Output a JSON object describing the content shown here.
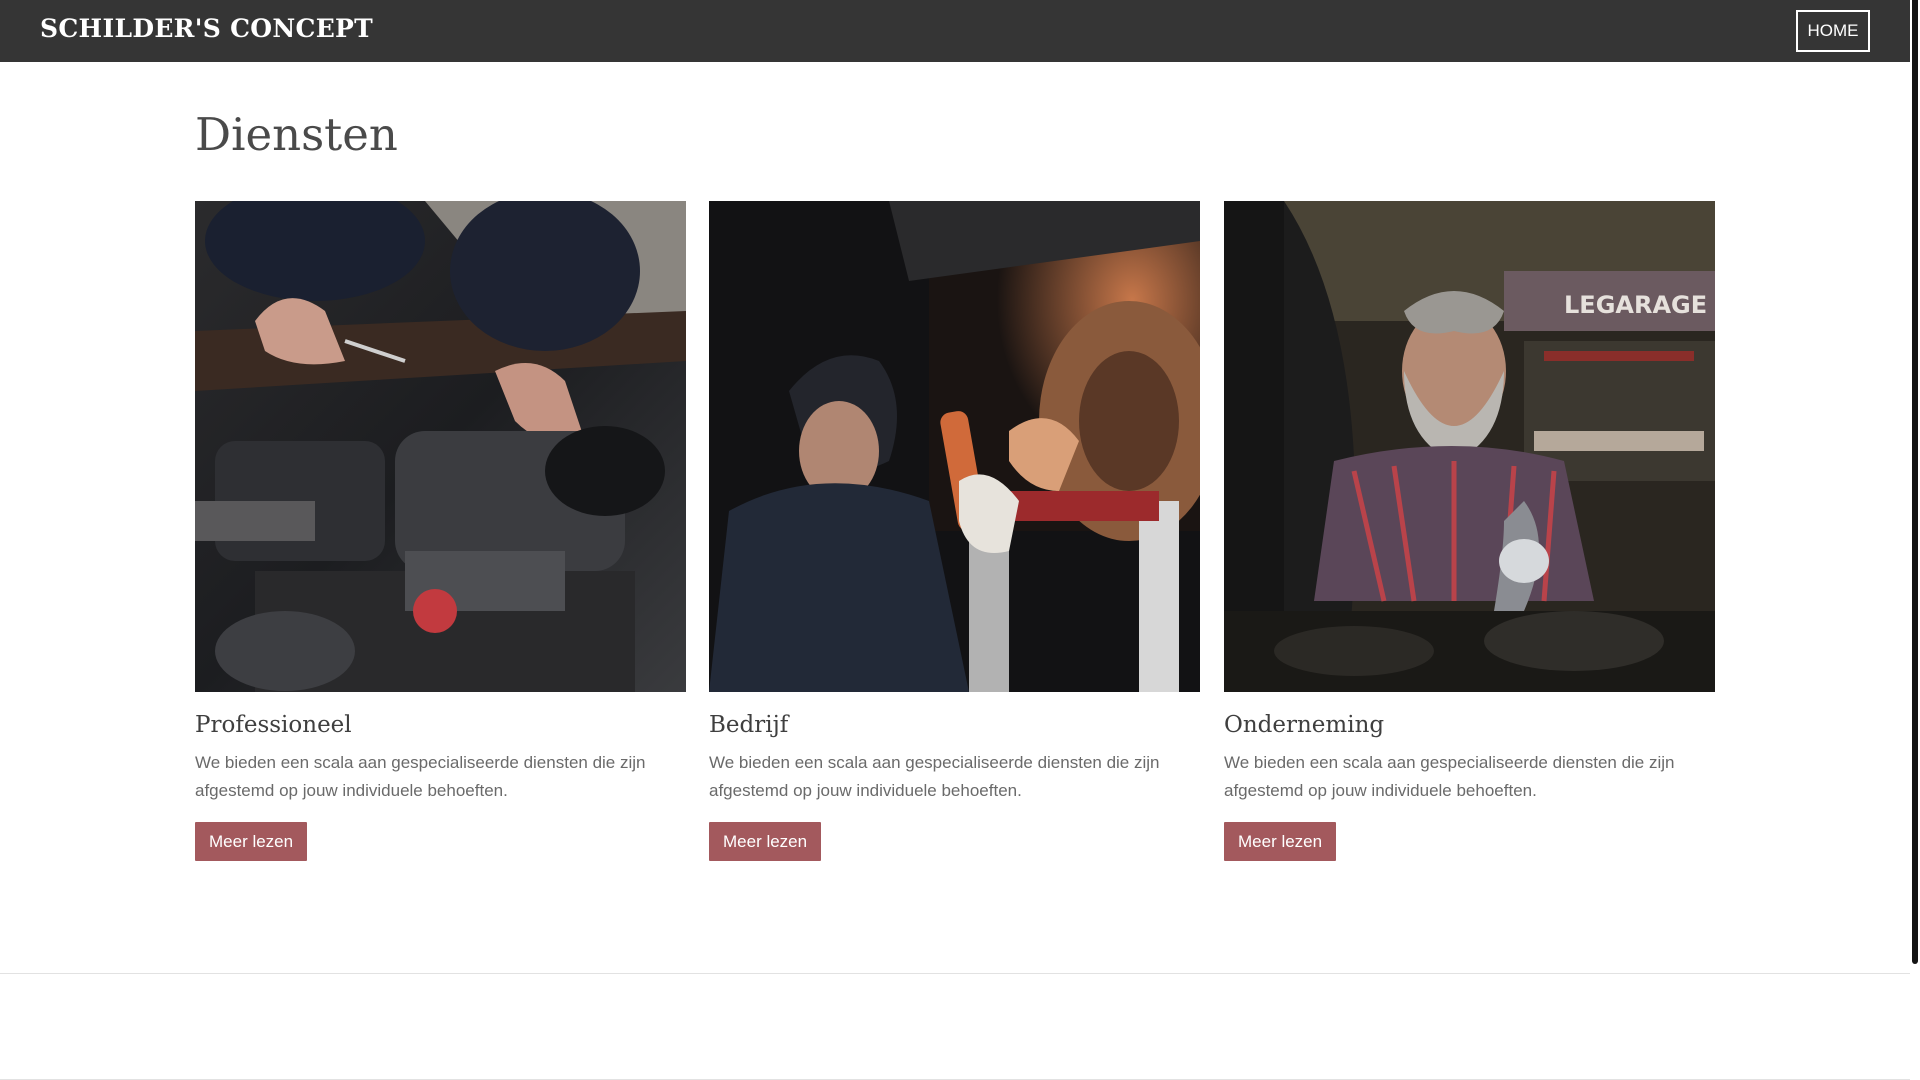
{
  "header": {
    "brand": "SCHILDER'S CONCEPT",
    "nav_home": "HOME"
  },
  "section": {
    "title": "Diensten"
  },
  "cards": [
    {
      "title": "Professioneel",
      "text": "We bieden een scala aan gespecialiseerde diensten die zijn afgestemd op jouw individuele behoeften.",
      "button": "Meer lezen",
      "image": "mechanic-engine-photo"
    },
    {
      "title": "Bedrijf",
      "text": "We bieden een scala aan gespecialiseerde diensten die zijn afgestemd op jouw individuele behoeften.",
      "button": "Meer lezen",
      "image": "mechanic-under-car-photo"
    },
    {
      "title": "Onderneming",
      "text": "We bieden een scala aan gespecialiseerde diensten die zijn afgestemd op jouw individuele behoeften.",
      "button": "Meer lezen",
      "image": "mechanic-garage-photo"
    }
  ],
  "colors": {
    "header_bg": "#353535",
    "button_bg": "#a3595d",
    "title_text": "#4a4a4a",
    "body_text": "#6a6a6a"
  }
}
